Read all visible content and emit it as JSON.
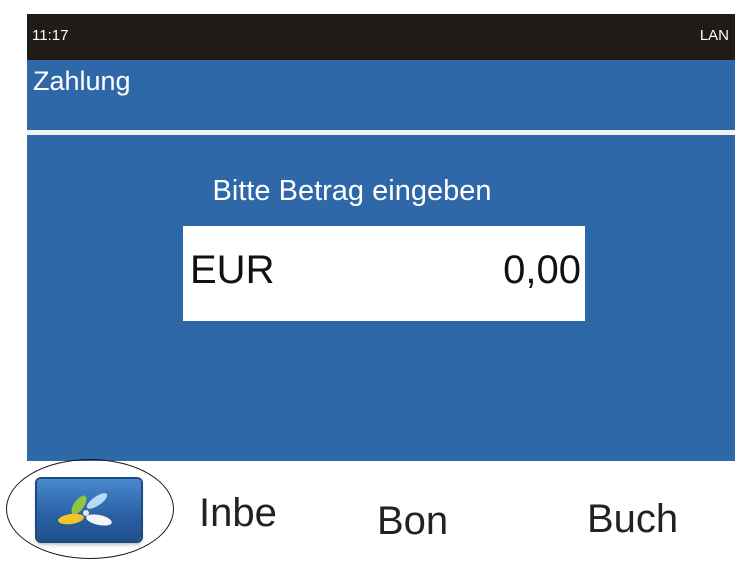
{
  "status_bar": {
    "time": "11:17",
    "connection": "LAN"
  },
  "header": {
    "title": "Zahlung"
  },
  "main": {
    "prompt": "Bitte Betrag eingeben",
    "currency": "EUR",
    "amount": "0,00"
  },
  "softkeys": {
    "logo_icon": "flower-logo-icon",
    "key_2": "Inbe",
    "key_3": "Bon",
    "key_4": "Buch"
  },
  "colors": {
    "status_bar": "#201a18",
    "screen_blue": "#2f68a8",
    "amount_box": "#ffffff"
  }
}
